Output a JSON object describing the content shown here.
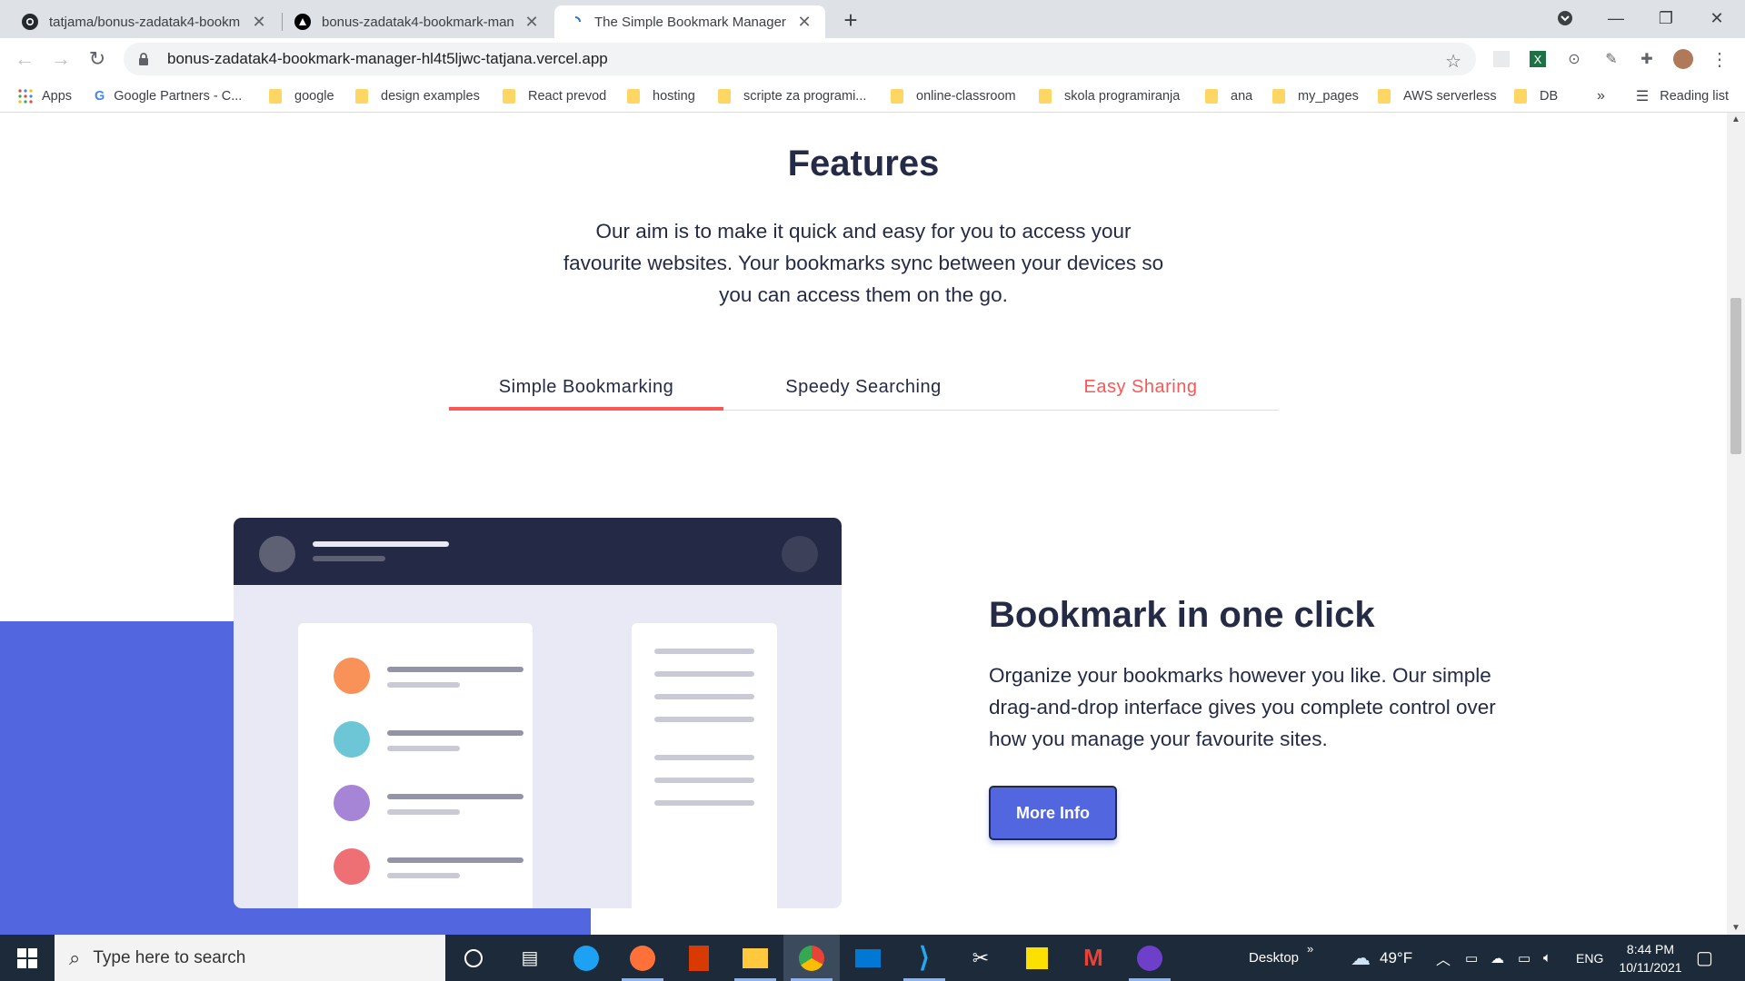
{
  "browser": {
    "tabs": [
      {
        "title": "tatjama/bonus-zadatak4-bookm"
      },
      {
        "title": "bonus-zadatak4-bookmark-man"
      },
      {
        "title": "The Simple Bookmark Manager"
      }
    ],
    "url": "bonus-zadatak4-bookmark-manager-hl4t5ljwc-tatjana.vercel.app",
    "bookmarks": [
      "Apps",
      "Google Partners - C...",
      "google",
      "design examples",
      "React prevod",
      "hosting",
      "scripte za programi...",
      "online-classroom",
      "skola programiranja",
      "ana",
      "my_pages",
      "AWS serverless",
      "DB"
    ],
    "overflow": "»",
    "reading_list": "Reading list"
  },
  "page": {
    "features_title": "Features",
    "features_desc": "Our aim is to make it quick and easy for you to access your favourite websites. Your bookmarks sync between your devices so you can access them on the go.",
    "feature_tabs": [
      "Simple Bookmarking",
      "Speedy Searching",
      "Easy Sharing"
    ],
    "section_title": "Bookmark in one click",
    "section_desc": "Organize your bookmarks however you like. Our simple drag-and-drop interface gives you complete control over how you manage your favourite sites.",
    "more_info": "More Info",
    "colors": {
      "primary": "#5267df",
      "accent": "#fa5757",
      "navy": "#242a45"
    }
  },
  "taskbar": {
    "search_placeholder": "Type here to search",
    "desktop_label": "Desktop",
    "temperature": "49°F",
    "language": "ENG",
    "time": "8:44 PM",
    "date": "10/11/2021"
  }
}
